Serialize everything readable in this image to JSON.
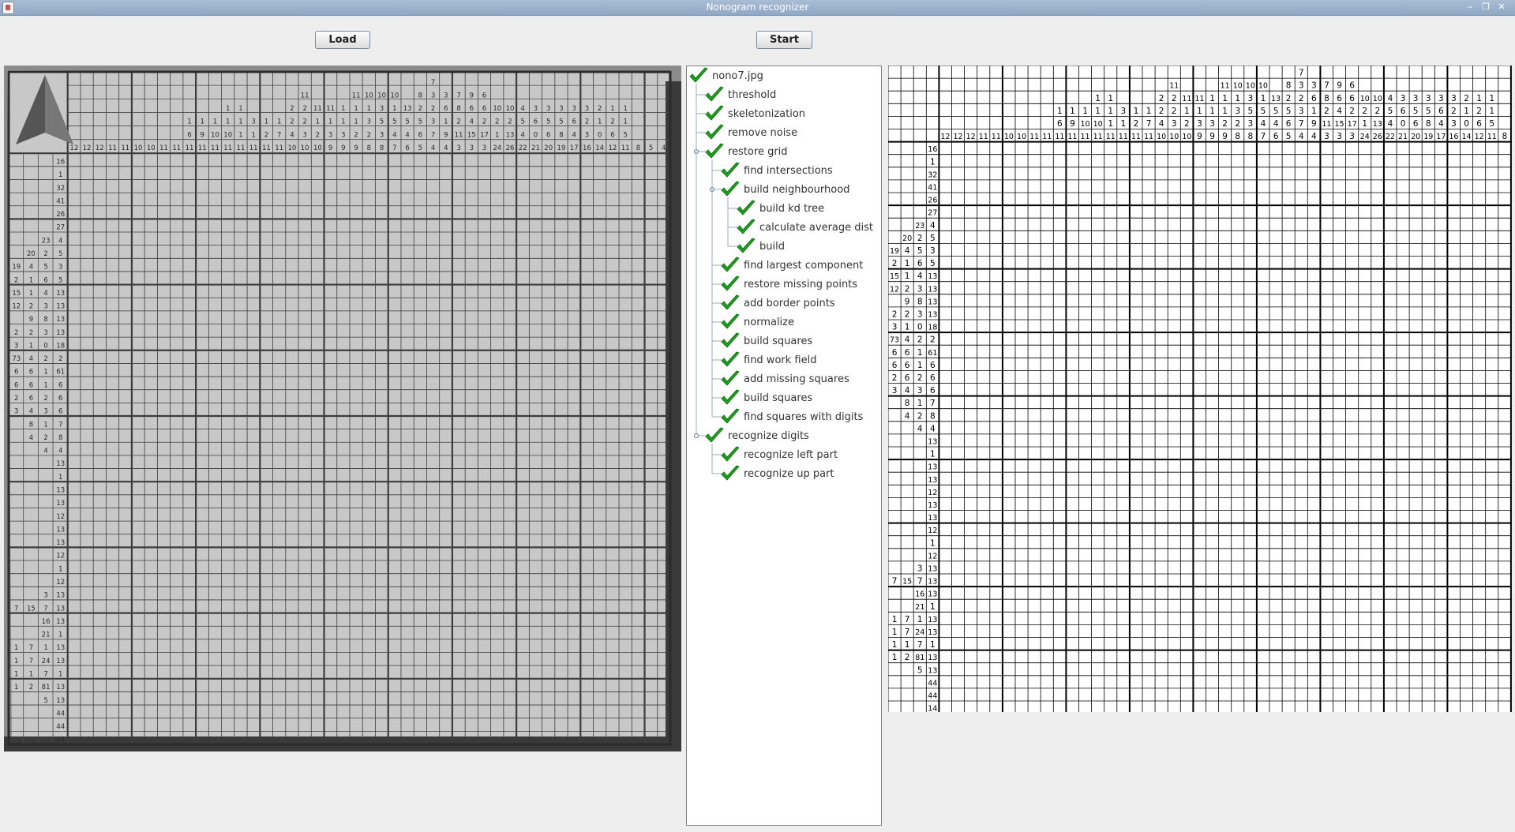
{
  "window": {
    "title": "Nonogram recognizer"
  },
  "toolbar": {
    "load_label": "Load",
    "start_label": "Start"
  },
  "photo": {
    "description_icon": "nonogram-photo"
  },
  "tree": [
    {
      "label": "nono7.jpg",
      "depth": 0,
      "expander": false
    },
    {
      "label": "threshold",
      "depth": 1,
      "expander": false
    },
    {
      "label": "skeletonization",
      "depth": 1,
      "expander": false
    },
    {
      "label": "remove noise",
      "depth": 1,
      "expander": false
    },
    {
      "label": "restore grid",
      "depth": 1,
      "expander": true
    },
    {
      "label": "find intersections",
      "depth": 2,
      "expander": false
    },
    {
      "label": "build neighbourhood",
      "depth": 2,
      "expander": true
    },
    {
      "label": "build kd tree",
      "depth": 3,
      "expander": false
    },
    {
      "label": "calculate average dist",
      "depth": 3,
      "expander": false
    },
    {
      "label": "build",
      "depth": 3,
      "expander": false
    },
    {
      "label": "find largest component",
      "depth": 2,
      "expander": false
    },
    {
      "label": "restore missing points",
      "depth": 2,
      "expander": false
    },
    {
      "label": "add border points",
      "depth": 2,
      "expander": false
    },
    {
      "label": "normalize",
      "depth": 2,
      "expander": false
    },
    {
      "label": "build squares",
      "depth": 2,
      "expander": false
    },
    {
      "label": "find work field",
      "depth": 2,
      "expander": false
    },
    {
      "label": "add missing squares",
      "depth": 2,
      "expander": false
    },
    {
      "label": "build squares",
      "depth": 2,
      "expander": false
    },
    {
      "label": "find squares with digits",
      "depth": 2,
      "expander": false
    },
    {
      "label": "recognize digits",
      "depth": 1,
      "expander": true
    },
    {
      "label": "recognize left part",
      "depth": 2,
      "expander": false
    },
    {
      "label": "recognize up part",
      "depth": 2,
      "expander": false
    }
  ],
  "nonogram": {
    "columns": [
      [
        "12"
      ],
      [
        "12"
      ],
      [
        "12"
      ],
      [
        "11"
      ],
      [
        "11"
      ],
      [
        "10"
      ],
      [
        "10"
      ],
      [
        "11"
      ],
      [
        "11"
      ],
      [
        "1",
        "6",
        "11"
      ],
      [
        "1",
        "9",
        "11"
      ],
      [
        "1",
        "10",
        "11"
      ],
      [
        "1",
        "1",
        "10",
        "11"
      ],
      [
        "1",
        "1",
        "1",
        "11"
      ],
      [
        "3",
        "1",
        "11"
      ],
      [
        "1",
        "2",
        "11"
      ],
      [
        "1",
        "7",
        "11"
      ],
      [
        "2",
        "2",
        "4",
        "10"
      ],
      [
        "11",
        "2",
        "2",
        "3",
        "10"
      ],
      [
        "11",
        "1",
        "2",
        "10"
      ],
      [
        "11",
        "1",
        "3",
        "9"
      ],
      [
        "1",
        "1",
        "3",
        "9"
      ],
      [
        "11",
        "1",
        "1",
        "2",
        "9"
      ],
      [
        "10",
        "1",
        "3",
        "2",
        "8"
      ],
      [
        "10",
        "3",
        "5",
        "3",
        "8"
      ],
      [
        "10",
        "1",
        "5",
        "4",
        "7"
      ],
      [
        "13",
        "5",
        "4",
        "6"
      ],
      [
        "8",
        "2",
        "5",
        "6",
        "5"
      ],
      [
        "7",
        "3",
        "2",
        "3",
        "7",
        "4"
      ],
      [
        "3",
        "6",
        "1",
        "9",
        "4"
      ],
      [
        "7",
        "8",
        "2",
        "11",
        "3"
      ],
      [
        "9",
        "6",
        "4",
        "15",
        "3"
      ],
      [
        "6",
        "6",
        "2",
        "17",
        "3"
      ],
      [
        "10",
        "2",
        "1",
        "24"
      ],
      [
        "10",
        "2",
        "13",
        "26"
      ],
      [
        "4",
        "5",
        "4",
        "22"
      ],
      [
        "3",
        "6",
        "0",
        "21"
      ],
      [
        "3",
        "5",
        "6",
        "20"
      ],
      [
        "3",
        "5",
        "8",
        "19"
      ],
      [
        "3",
        "6",
        "4",
        "17"
      ],
      [
        "3",
        "2",
        "3",
        "16"
      ],
      [
        "2",
        "1",
        "0",
        "14"
      ],
      [
        "1",
        "2",
        "6",
        "12"
      ],
      [
        "1",
        "1",
        "5",
        "11"
      ],
      [
        "8"
      ],
      [
        "5"
      ],
      [
        "4"
      ]
    ],
    "rows": [
      [
        "16"
      ],
      [
        "1"
      ],
      [
        "32"
      ],
      [
        "41"
      ],
      [
        "26"
      ],
      [
        "27"
      ],
      [
        "23",
        "4"
      ],
      [
        "20",
        "2",
        "5"
      ],
      [
        "19",
        "4",
        "5",
        "3"
      ],
      [
        "2",
        "1",
        "6",
        "5"
      ],
      [
        "15",
        "1",
        "4",
        "13"
      ],
      [
        "12",
        "2",
        "3",
        "13"
      ],
      [
        "9",
        "8",
        "13"
      ],
      [
        "2",
        "2",
        "3",
        "13"
      ],
      [
        "3",
        "1",
        "0",
        "18"
      ],
      [
        "73",
        "4",
        "2",
        "2"
      ],
      [
        "6",
        "6",
        "1",
        "61"
      ],
      [
        "6",
        "6",
        "1",
        "6"
      ],
      [
        "2",
        "6",
        "2",
        "6"
      ],
      [
        "3",
        "4",
        "3",
        "6"
      ],
      [
        "8",
        "1",
        "7"
      ],
      [
        "4",
        "2",
        "8"
      ],
      [
        "4",
        "4"
      ],
      [
        "13"
      ],
      [
        "1"
      ],
      [
        "13"
      ],
      [
        "13"
      ],
      [
        "12"
      ],
      [
        "13"
      ],
      [
        "13"
      ],
      [
        "12"
      ],
      [
        "1"
      ],
      [
        "12"
      ],
      [
        "3",
        "13"
      ],
      [
        "7",
        "15",
        "7",
        "13"
      ],
      [
        "16",
        "13"
      ],
      [
        "21",
        "1"
      ],
      [
        "1",
        "7",
        "1",
        "13"
      ],
      [
        "1",
        "7",
        "24",
        "13"
      ],
      [
        "1",
        "1",
        "7",
        "1"
      ],
      [
        "1",
        "2",
        "81",
        "13"
      ],
      [
        "5",
        "13"
      ],
      [
        "44"
      ],
      [
        "44"
      ],
      [
        "14"
      ]
    ]
  },
  "colors": {
    "check": "#1e9e1e",
    "grid_line": "#000000",
    "photo_bg": "#8c8c8c"
  }
}
